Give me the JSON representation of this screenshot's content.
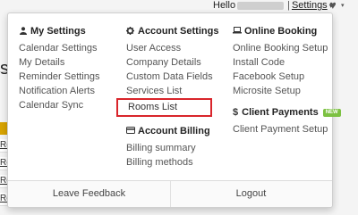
{
  "topbar": {
    "hello_label": "Hello",
    "separator": "|",
    "settings_label": "Settings",
    "caret": "▾",
    "heart_icon": "♥",
    "heart_caret": "▾"
  },
  "background": {
    "title_fragment": "s",
    "row_fragment": "Re"
  },
  "menu": {
    "my_settings": {
      "title": "My Settings",
      "icon": "user-icon",
      "items": [
        "Calendar Settings",
        "My Details",
        "Reminder Settings",
        "Notification Alerts",
        "Calendar Sync"
      ]
    },
    "account_settings": {
      "title": "Account Settings",
      "icon": "gear-icon",
      "items": [
        "User Access",
        "Company Details",
        "Custom Data Fields",
        "Services List",
        "Rooms List"
      ]
    },
    "account_billing": {
      "title": "Account Billing",
      "icon": "credit-card-icon",
      "items": [
        "Billing summary",
        "Billing methods"
      ]
    },
    "online_booking": {
      "title": "Online Booking",
      "icon": "laptop-icon",
      "items": [
        "Online Booking Setup",
        "Install Code",
        "Facebook Setup",
        "Microsite Setup"
      ]
    },
    "client_payments": {
      "title": "Client Payments",
      "icon": "dollar-icon",
      "badge": "NEW",
      "items": [
        "Client Payment Setup"
      ]
    }
  },
  "footer": {
    "leave_feedback": "Leave Feedback",
    "logout": "Logout"
  },
  "colors": {
    "highlight_border": "#d9252b",
    "badge": "#7cc142"
  }
}
